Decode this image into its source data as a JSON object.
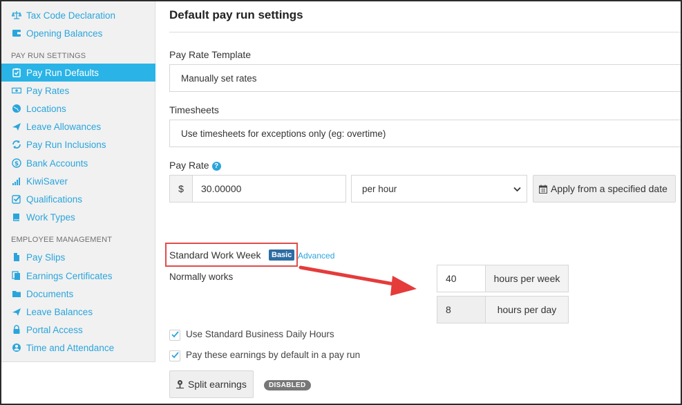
{
  "sidebar": {
    "items_top": [
      {
        "label": "Tax Code Declaration",
        "icon": "scales-icon"
      },
      {
        "label": "Opening Balances",
        "icon": "wallet-icon"
      }
    ],
    "section_pay_run": "PAY RUN SETTINGS",
    "items_pay_run": [
      {
        "label": "Pay Run Defaults",
        "icon": "clipboard-check-icon",
        "active": true
      },
      {
        "label": "Pay Rates",
        "icon": "money-icon"
      },
      {
        "label": "Locations",
        "icon": "globe-icon"
      },
      {
        "label": "Leave Allowances",
        "icon": "plane-icon"
      },
      {
        "label": "Pay Run Inclusions",
        "icon": "refresh-icon"
      },
      {
        "label": "Bank Accounts",
        "icon": "dollar-circle-icon"
      },
      {
        "label": "KiwiSaver",
        "icon": "signal-bars-icon"
      },
      {
        "label": "Qualifications",
        "icon": "checkbox-icon"
      },
      {
        "label": "Work Types",
        "icon": "book-icon"
      }
    ],
    "section_employee": "EMPLOYEE MANAGEMENT",
    "items_employee": [
      {
        "label": "Pay Slips",
        "icon": "document-icon"
      },
      {
        "label": "Earnings Certificates",
        "icon": "copy-icon"
      },
      {
        "label": "Documents",
        "icon": "folder-icon"
      },
      {
        "label": "Leave Balances",
        "icon": "plane-icon"
      },
      {
        "label": "Portal Access",
        "icon": "lock-icon"
      },
      {
        "label": "Time and Attendance",
        "icon": "user-clock-icon"
      }
    ]
  },
  "main": {
    "title": "Default pay run settings",
    "pay_rate_template_label": "Pay Rate Template",
    "pay_rate_template_value": "Manually set rates",
    "timesheets_label": "Timesheets",
    "timesheets_value": "Use timesheets for exceptions only (eg: overtime)",
    "pay_rate_label": "Pay Rate",
    "pay_rate_help": "?",
    "currency_symbol": "$",
    "pay_rate_value": "30.00000",
    "pay_rate_unit": "per hour",
    "apply_button": "Apply from a specified date",
    "standard_work_week_label": "Standard Work Week",
    "basic_badge": "Basic",
    "advanced_link": "Advanced",
    "normally_works_label": "Normally works",
    "hours_per_week_value": "40",
    "hours_per_week_suffix": "hours per week",
    "hours_per_day_value": "8",
    "hours_per_day_suffix": "hours per day",
    "use_standard_hours_label": "Use Standard Business Daily Hours",
    "use_standard_hours_checked": true,
    "pay_by_default_label": "Pay these earnings by default in a pay run",
    "pay_by_default_checked": true,
    "split_earnings_button": "Split earnings",
    "disabled_badge": "DISABLED"
  },
  "colors": {
    "accent": "#2aa5dc",
    "active_bg": "#2ab3e6",
    "highlight": "#e04b4b",
    "basic_badge": "#2d6ca3"
  }
}
